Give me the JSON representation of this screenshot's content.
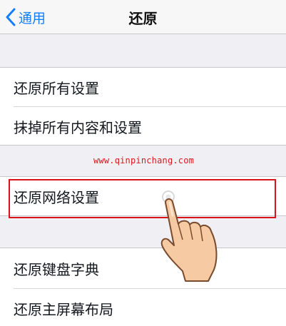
{
  "navbar": {
    "back_label": "通用",
    "title": "还原"
  },
  "groups": {
    "first": [
      "还原所有设置",
      "抹掉所有内容和设置"
    ],
    "second": [
      "还原网络设置"
    ],
    "third": [
      "还原键盘字典",
      "还原主屏幕布局"
    ]
  },
  "watermark": "www.qinpinchang.com",
  "colors": {
    "accent": "#147efb",
    "highlight": "#d8141a",
    "background": "#efeff4"
  },
  "icons": {
    "back": "chevron-left-icon",
    "pointer": "pointing-hand-icon"
  }
}
